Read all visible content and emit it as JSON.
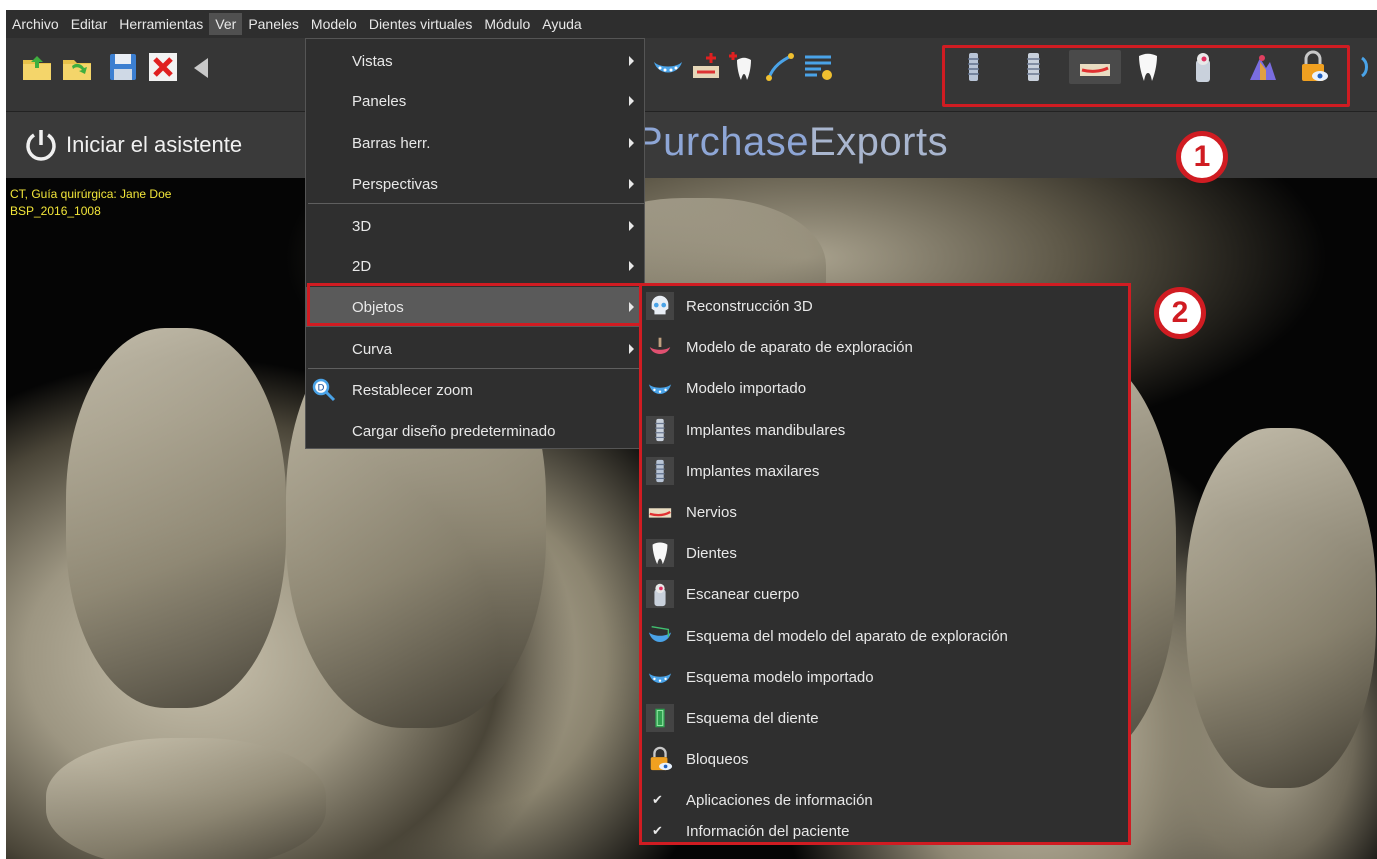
{
  "menubar": {
    "items": [
      "Archivo",
      "Editar",
      "Herramientas",
      "Ver",
      "Paneles",
      "Modelo",
      "Dientes virtuales",
      "Módulo",
      "Ayuda"
    ],
    "active": "Ver"
  },
  "assistant": {
    "label": "Iniciar el asistente"
  },
  "brand": {
    "part1": "Purchase",
    "part2": "Exports"
  },
  "patient": {
    "line1": "CT, Guía quirúrgica: Jane Doe",
    "line2": "BSP_2016_1008"
  },
  "badges": {
    "one": "1",
    "two": "2"
  },
  "ver_menu": {
    "items": [
      {
        "label": "Vistas",
        "submenu": true
      },
      {
        "label": "Paneles",
        "submenu": true
      },
      {
        "label": "Barras herr.",
        "submenu": true
      },
      {
        "label": "Perspectivas",
        "submenu": true
      },
      {
        "label": "3D",
        "submenu": true
      },
      {
        "label": "2D",
        "submenu": true
      },
      {
        "label": "Objetos",
        "submenu": true
      },
      {
        "label": "Curva",
        "submenu": true
      },
      {
        "label": "Restablecer zoom",
        "submenu": false
      },
      {
        "label": "Cargar diseño predeterminado",
        "submenu": false
      }
    ],
    "active": "Objetos"
  },
  "objetos_menu": {
    "items": [
      {
        "label": "Reconstrucción 3D",
        "icon": "skull-icon"
      },
      {
        "label": "Modelo de aparato de exploración",
        "icon": "scan-appliance-icon"
      },
      {
        "label": "Modelo importado",
        "icon": "imported-model-icon"
      },
      {
        "label": "Implantes mandibulares",
        "icon": "mandibular-implant-icon"
      },
      {
        "label": "Implantes maxilares",
        "icon": "maxillary-implant-icon"
      },
      {
        "label": "Nervios",
        "icon": "nerve-icon"
      },
      {
        "label": "Dientes",
        "icon": "tooth-icon"
      },
      {
        "label": "Escanear cuerpo",
        "icon": "scanbody-icon"
      },
      {
        "label": "Esquema del modelo del aparato de exploración",
        "icon": "scan-appliance-outline-icon"
      },
      {
        "label": "Esquema modelo importado",
        "icon": "imported-model-outline-icon"
      },
      {
        "label": "Esquema del diente",
        "icon": "tooth-outline-icon"
      },
      {
        "label": "Bloqueos",
        "icon": "lock-icon"
      },
      {
        "label": "Aplicaciones de información",
        "icon": "check-icon"
      },
      {
        "label": "Información del paciente",
        "icon": "check-icon"
      }
    ]
  },
  "colors": {
    "highlight": "#d01c22",
    "menu_bg": "#2f2f2f",
    "patient_text": "#f2e63a"
  }
}
